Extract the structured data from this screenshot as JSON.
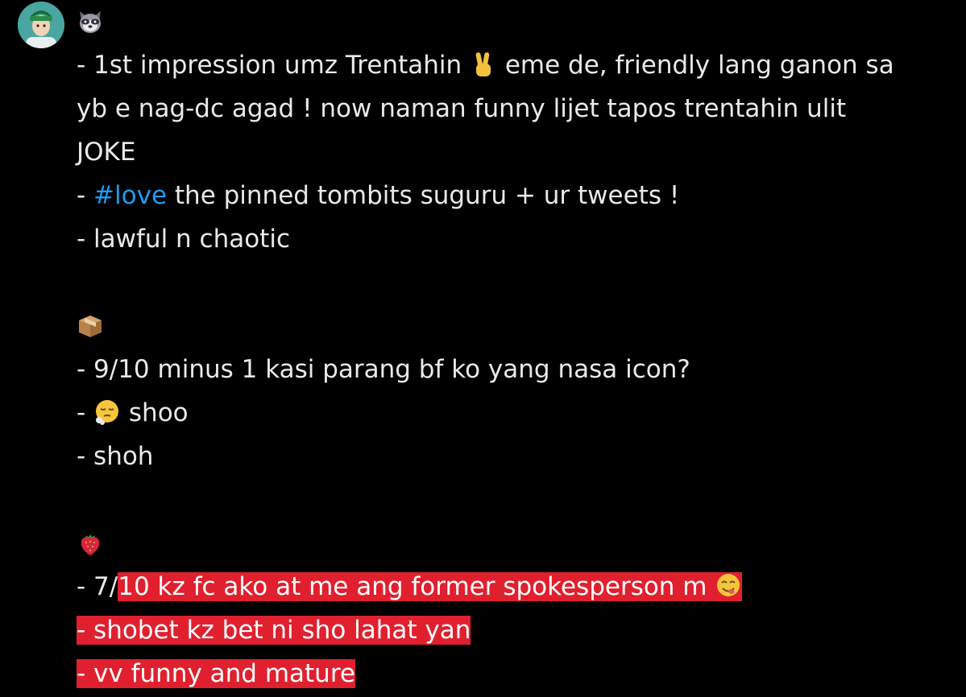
{
  "tweet": {
    "section1": {
      "emoji": "raccoon-face",
      "line1_a": "- 1st impression umz Trentahin ",
      "line1_emoji": "victory-hand",
      "line1_b": " eme de, friendly lang ganon sa",
      "line2": "yb e nag-dc agad ! now naman funny lijet tapos trentahin ulit",
      "line3": "JOKE",
      "line4_a": "- ",
      "line4_hashtag": "#love",
      "line4_b": " the pinned tombits suguru + ur tweets !",
      "line5": "- lawful n chaotic"
    },
    "section2": {
      "emoji": "package",
      "line1": "- 9/10 minus 1 kasi parang bf ko yang nasa icon?",
      "line2_a": "- ",
      "line2_emoji": "face-exhaling",
      "line2_b": " shoo",
      "line3": "- shoh"
    },
    "section3": {
      "emoji": "strawberry",
      "line1_a": "- 7/",
      "line1_hl": "10 kz fc ako at me ang former spokesperson m ",
      "line1_emoji": "face-savoring-food",
      "line2": "- shobet kz bet ni sho lahat yan",
      "line3": "- vv funny and mature"
    }
  },
  "colors": {
    "background": "#000000",
    "text": "#e7e9ea",
    "hashtag": "#1d9bf0",
    "highlight": "#e0202f"
  }
}
